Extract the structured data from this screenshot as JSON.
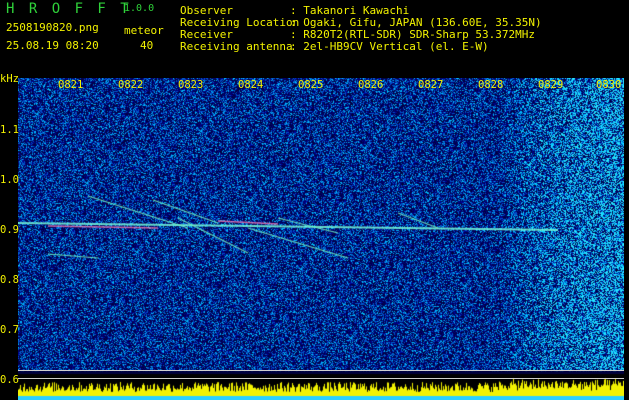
{
  "header": {
    "app_title": "H R O F F T",
    "app_version": "1.0.0",
    "file_name": "2508190820.png",
    "meteor_label": "meteor",
    "timestamp": "25.08.19 08:20",
    "meteor_count": "40",
    "info": [
      {
        "key": "Observer",
        "value": ": Takanori Kawachi"
      },
      {
        "key": "Receiving Location",
        "value": ": Ogaki, Gifu, JAPAN (136.60E, 35.35N)"
      },
      {
        "key": "Receiver",
        "value": ": R820T2(RTL-SDR) SDR-Sharp 53.372MHz"
      },
      {
        "key": "Receiving antenna",
        "value": ": 2el-HB9CV Vertical (el. E-W)"
      }
    ]
  },
  "axes": {
    "y_unit": "kHz",
    "x_ticks": [
      "0821",
      "0822",
      "0823",
      "0824",
      "0825",
      "0826",
      "0827",
      "0828",
      "0829",
      "0830"
    ],
    "y_ticks": [
      "1.1",
      "1.0",
      "0.9",
      "0.8",
      "0.7",
      "0.6"
    ]
  },
  "colors": {
    "header_text": "#2fd23a",
    "tick_text": "#f2f200",
    "background": "#000000",
    "spectro_bg": "#00004a",
    "noise_low": "#0000c8",
    "noise_high": "#00c8ff",
    "bottom_band": "#f2f200"
  }
}
